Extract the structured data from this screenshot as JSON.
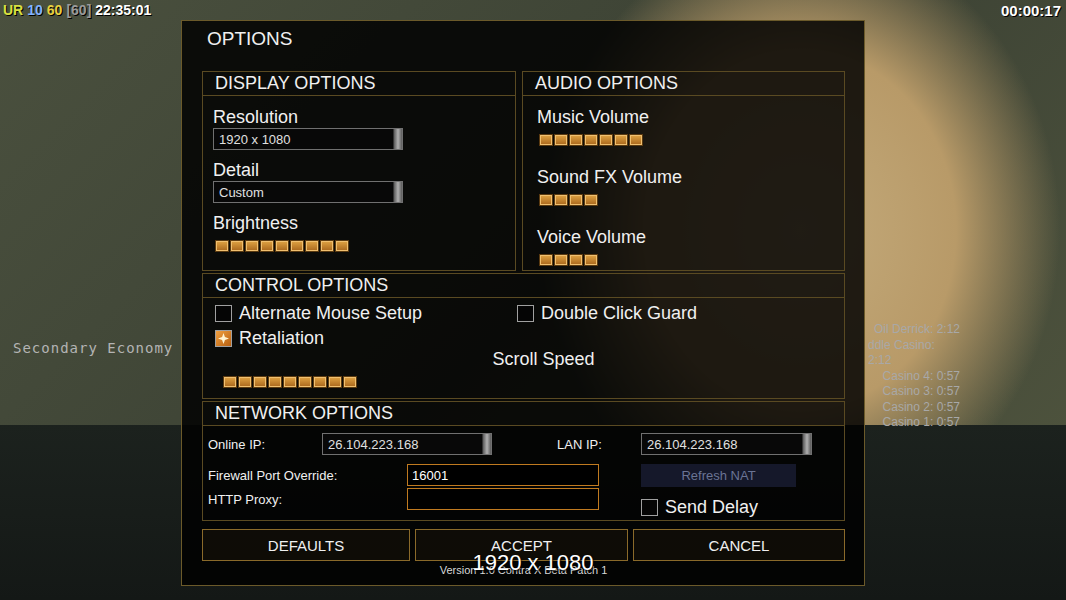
{
  "hud": {
    "stats": [
      {
        "text": "UR",
        "color": "#d8e040"
      },
      {
        "text": "10",
        "color": "#7fb2ff"
      },
      {
        "text": "60",
        "color": "#e8d040"
      },
      {
        "text": "[60]",
        "color": "#9a9a9a"
      },
      {
        "text": "22:35:01",
        "color": "#ffffff"
      }
    ],
    "clock": "00:00:17",
    "label": "Secondary Economy",
    "timers": [
      "Oil Derrick: 2:12",
      "ddle Casino: 2:12",
      "Casino 4: 0:57",
      "Casino 3: 0:57",
      "Casino 2: 0:57",
      "Casino 1: 0:57"
    ]
  },
  "window": {
    "title": "OPTIONS"
  },
  "display": {
    "title": "DISPLAY OPTIONS",
    "items": [
      {
        "kind": "dropdown",
        "label": "Resolution",
        "value": "1920 x 1080"
      },
      {
        "kind": "dropdown",
        "label": "Detail",
        "value": "Custom"
      },
      {
        "kind": "slider",
        "label": "Brightness",
        "level": 0.9
      }
    ]
  },
  "audio": {
    "title": "AUDIO OPTIONS",
    "items": [
      {
        "kind": "slider",
        "label": "Music Volume",
        "level": 0.7
      },
      {
        "kind": "slider",
        "label": "Sound FX Volume",
        "level": 0.4
      },
      {
        "kind": "slider",
        "label": "Voice Volume",
        "level": 0.4
      }
    ]
  },
  "controls": {
    "title": "CONTROL OPTIONS",
    "checkboxes": [
      {
        "label": "Alternate Mouse Setup",
        "checked": false
      },
      {
        "label": "Double Click Guard",
        "checked": false
      },
      {
        "label": "Retaliation",
        "checked": true
      }
    ],
    "scroll": {
      "label": "Scroll Speed",
      "level": 0.9
    }
  },
  "network": {
    "title": "NETWORK OPTIONS",
    "online_ip": {
      "label": "Online IP:",
      "value": "26.104.223.168"
    },
    "lan_ip": {
      "label": "LAN IP:",
      "value": "26.104.223.168"
    },
    "firewall": {
      "label": "Firewall Port Override:",
      "value": "16001"
    },
    "proxy": {
      "label": "HTTP Proxy:",
      "value": ""
    },
    "refresh_nat": {
      "label": "Refresh NAT",
      "disabled": true
    },
    "send_delay": {
      "label": "Send Delay",
      "checked": false
    }
  },
  "buttons": [
    "DEFAULTS",
    "ACCEPT",
    "CANCEL"
  ],
  "version": "Version 1.0 Contra X Beta Patch 1",
  "toast": "1920 x 1080"
}
